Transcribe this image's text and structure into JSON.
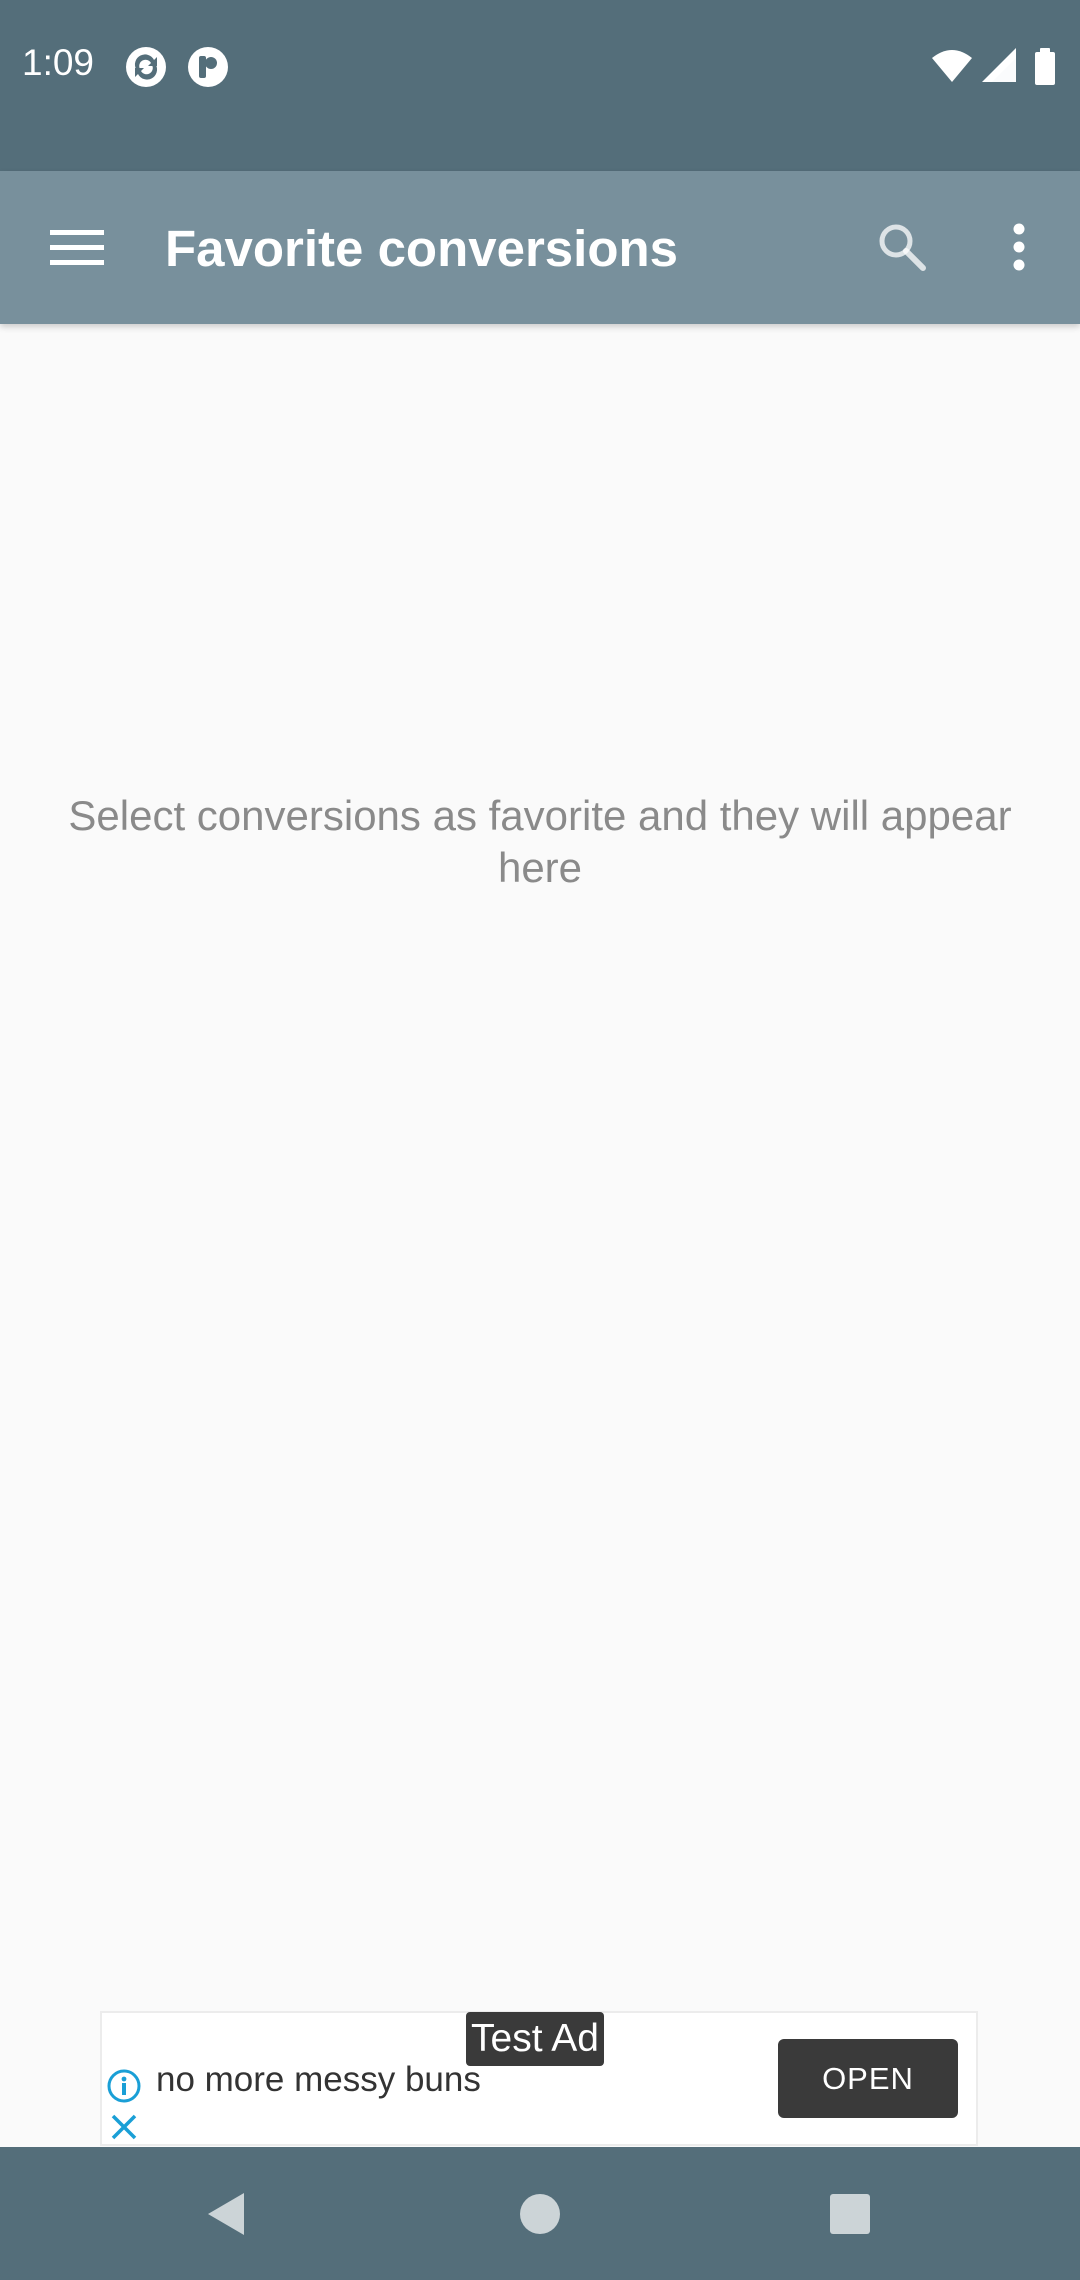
{
  "status_bar": {
    "time": "1:09",
    "icons": [
      "sync-app-icon",
      "p-app-icon",
      "wifi-icon",
      "signal-icon",
      "battery-icon"
    ]
  },
  "app_bar": {
    "title": "Favorite conversions",
    "menu_icon": "hamburger-menu-icon",
    "search_icon": "search-icon",
    "overflow_icon": "more-vert-icon"
  },
  "main": {
    "empty_message": "Select conversions as favorite and they will appear here"
  },
  "ad": {
    "label": "Test Ad",
    "headline": "no more messy buns",
    "button_label": "OPEN",
    "info_icon": "info-icon",
    "close_icon": "close-icon"
  },
  "nav_bar": {
    "icons": [
      "back-icon",
      "home-icon",
      "recents-icon"
    ]
  },
  "colors": {
    "status_bar": "#546e7a",
    "app_bar": "#78909c",
    "background": "#fafafa",
    "ad_accent": "#1a9fd6",
    "ad_button": "#3a3a3a"
  }
}
